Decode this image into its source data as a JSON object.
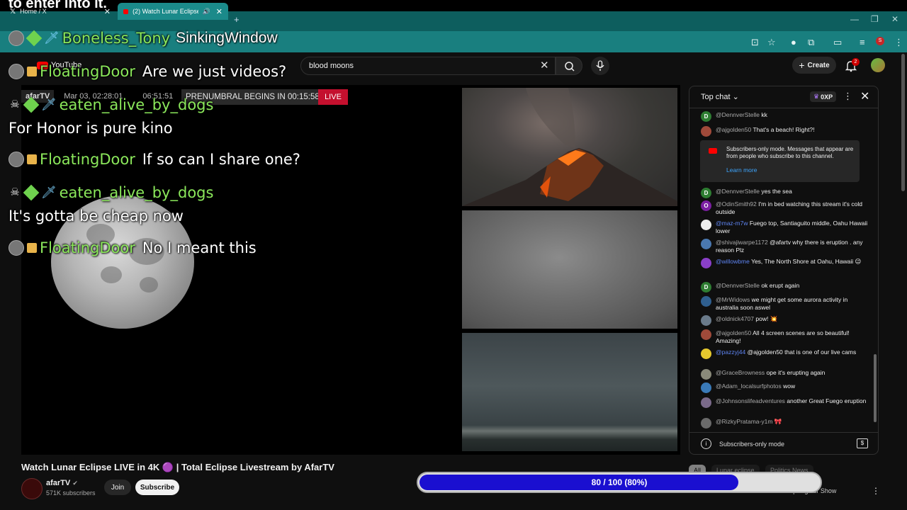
{
  "caption": "to enter into it.",
  "browser": {
    "tabs": [
      {
        "label": "Home / X"
      },
      {
        "label": "(2) Watch Lunar Eclipse LIVE"
      }
    ],
    "new_tab": "+"
  },
  "youtube": {
    "logo": "YouTube",
    "search": {
      "value": "blood moons",
      "placeholder": "Search"
    },
    "create_label": "Create",
    "notifications_count": "2"
  },
  "player": {
    "channel_tag": "afarTV",
    "date": "Mar 03, 02:28:01",
    "time": "06:51:51",
    "prenumbral": "PRENUMBRAL BEGINS IN 00:15:58",
    "live": "LIVE"
  },
  "overlay": {
    "header_names": [
      "Boneless_Tony",
      "SinkingWindow"
    ],
    "messages": [
      {
        "name": "FloatingDoor",
        "text": "Are we just videos?"
      },
      {
        "name": "eaten_alive_by_dogs",
        "text": "For Honor is pure kino"
      },
      {
        "name": "FloatingDoor",
        "text": "If so can I share one?"
      },
      {
        "name": "eaten_alive_by_dogs",
        "text": "It's gotta be cheap now"
      },
      {
        "name": "FloatingDoor",
        "text": "No I meant this"
      }
    ]
  },
  "video": {
    "title": "Watch Lunar Eclipse LIVE in 4K 🟣 | Total Eclipse Livestream by AfarTV",
    "channel": "afarTV",
    "subscribers": "571K subscribers",
    "join": "Join",
    "subscribe": "Subscribe"
  },
  "progress": {
    "label": "80 / 100 (80%)",
    "value": 0.8
  },
  "chips": [
    "All",
    "Lunar eclipse",
    "Politics News"
  ],
  "recommendation_peek": "Live | Regular Show",
  "chat": {
    "mode": "Top chat",
    "xp": "0XP",
    "notice": {
      "text": "Subscribers-only mode. Messages that appear are from people who subscribe to this channel.",
      "link": "Learn more"
    },
    "footer": "Subscribers-only mode",
    "messages": [
      {
        "author": "@DennverStelle",
        "text": "kk",
        "initial": "D",
        "color": "#2e7d32"
      },
      {
        "author": "@ajgolden50",
        "text": "That's a beach! Right?!",
        "initial": "",
        "color": "#a04a3a"
      },
      {
        "author": "@DennverStelle",
        "text": "yes the sea",
        "initial": "D",
        "color": "#2e7d32"
      },
      {
        "author": "@OdinSmith92",
        "text": "I'm in bed watching this stream it's cold outside",
        "initial": "O",
        "color": "#7b1fa2"
      },
      {
        "author": "@maz-m7w",
        "text": "Fuego top, Santiaguito middle, Oahu Hawaii lower",
        "initial": "",
        "color": "#eeeeee",
        "mod": true
      },
      {
        "author": "@shivajiwarpe1172",
        "text": "@afartv why there is eruption . any reason Plz",
        "initial": "",
        "color": "#4a78b0"
      },
      {
        "author": "@willowbme",
        "text": "Yes, The North Shore at Oahu, Hawaii 😉",
        "initial": "",
        "color": "#8a3fc8",
        "mod": true
      },
      {
        "author": "@DennverStelle",
        "text": "ok erupt again",
        "initial": "D",
        "color": "#2e7d32"
      },
      {
        "author": "@MrWidows",
        "text": "we might get some aurora activity in australia soon aswel",
        "initial": "",
        "color": "#2f5f8f"
      },
      {
        "author": "@oldnick4707",
        "text": "pow! 💥",
        "initial": "",
        "color": "#6a7a8a"
      },
      {
        "author": "@ajgolden50",
        "text": "All 4 screen scenes are so beautiful! Amazing!",
        "initial": "",
        "color": "#a04a3a"
      },
      {
        "author": "@pazzyj44",
        "text": "@ajgolden50 that is one of our live cams",
        "initial": "",
        "color": "#e6c92e",
        "mod": true
      },
      {
        "author": "@GraceBrowness",
        "text": "ope it's erupting again",
        "initial": "",
        "color": "#8a8a7a"
      },
      {
        "author": "@Adam_localsurfphotos",
        "text": "wow",
        "initial": "",
        "color": "#3a7ab8"
      },
      {
        "author": "@Johnsonslifeadventures",
        "text": "another Great Fuego eruption",
        "initial": "",
        "color": "#7a6a8a"
      },
      {
        "author": "@RizkyPratama-y1m",
        "text": "🎀",
        "initial": "",
        "color": "#6a6a6a"
      }
    ]
  }
}
